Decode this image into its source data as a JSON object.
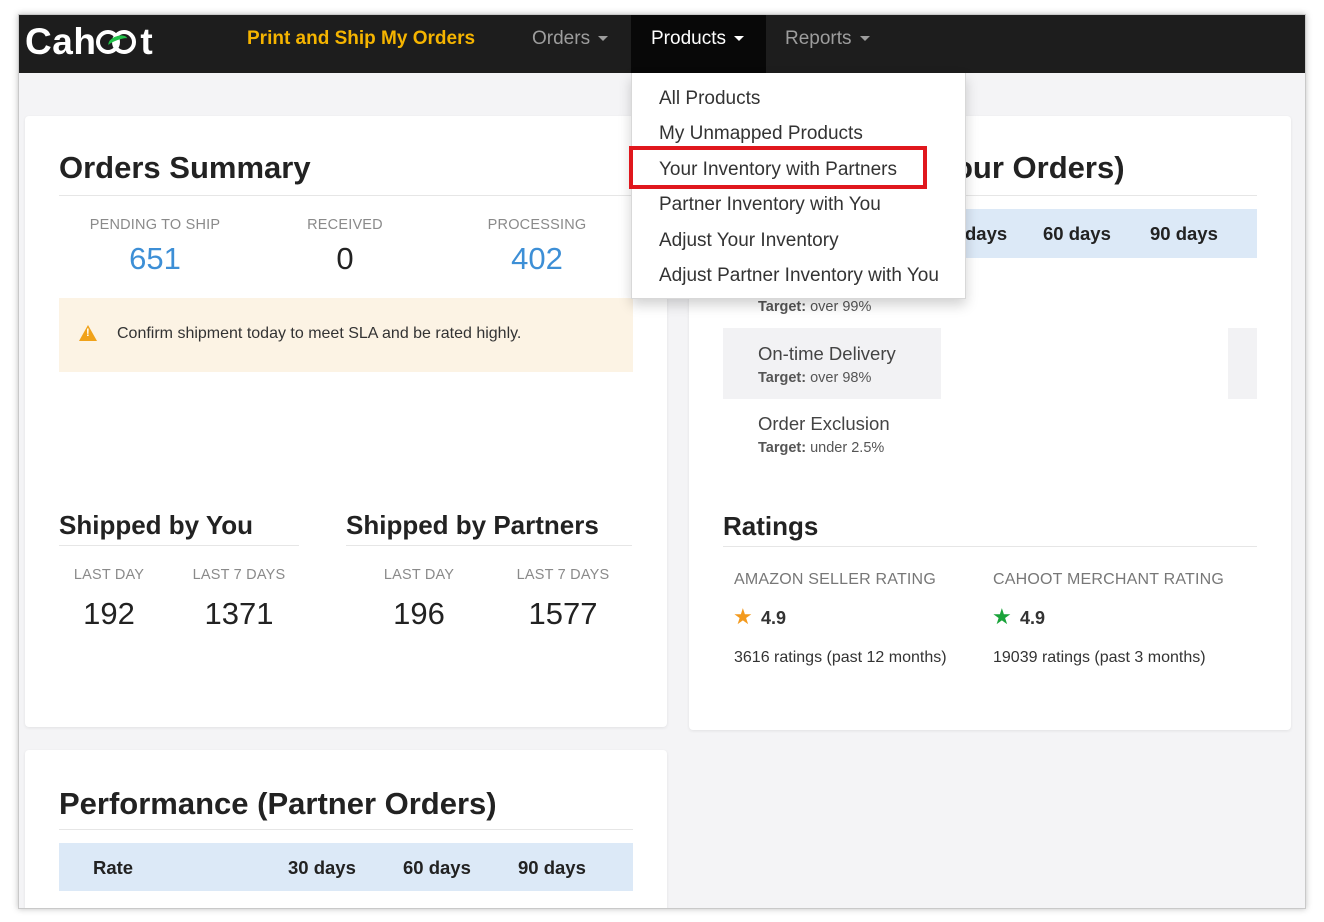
{
  "navbar": {
    "logo": "Cahoot",
    "print_ship": "Print and Ship My Orders",
    "orders": "Orders",
    "products": "Products",
    "reports": "Reports"
  },
  "products_menu": {
    "items": [
      "All Products",
      "My Unmapped Products",
      "Your Inventory with Partners",
      "Partner Inventory with You",
      "Adjust Your Inventory",
      "Adjust Partner Inventory with You"
    ],
    "highlighted_item": "Your Inventory with Partners",
    "highlight_color": "#e0171d"
  },
  "orders_summary": {
    "title": "Orders Summary",
    "stats": [
      {
        "label": "PENDING TO SHIP",
        "value": "651"
      },
      {
        "label": "RECEIVED",
        "value": "0"
      },
      {
        "label": "PROCESSING",
        "value": "402"
      }
    ],
    "alert": "Confirm shipment today to meet SLA and be rated highly.",
    "shipped_by_you": {
      "title": "Shipped by You",
      "cols": [
        {
          "label": "LAST DAY",
          "value": "192"
        },
        {
          "label": "LAST 7 DAYS",
          "value": "1371"
        }
      ]
    },
    "shipped_by_partners": {
      "title": "Shipped by Partners",
      "cols": [
        {
          "label": "LAST DAY",
          "value": "196"
        },
        {
          "label": "LAST 7 DAYS",
          "value": "1577"
        }
      ]
    }
  },
  "performance_your_orders": {
    "title_visible": "our Orders)",
    "headers": [
      "days",
      "60 days",
      "90 days"
    ],
    "metrics": [
      {
        "target_label": "Target:",
        "target": "over 99%"
      },
      {
        "name": "On-time Delivery",
        "target_label": "Target:",
        "target": "over 98%"
      },
      {
        "name": "Order Exclusion",
        "target_label": "Target:",
        "target": "under 2.5%"
      }
    ]
  },
  "ratings": {
    "title": "Ratings",
    "amazon": {
      "label": "AMAZON SELLER RATING",
      "value": "4.9",
      "count": "3616 ratings (past 12 months)",
      "star_color": "#f39a1e"
    },
    "cahoot": {
      "label": "CAHOOT MERCHANT RATING",
      "value": "4.9",
      "count": "19039 ratings (past 3 months)",
      "star_color": "#1aa33a"
    }
  },
  "performance_partner_orders": {
    "title": "Performance (Partner Orders)",
    "headers": [
      "Rate",
      "30 days",
      "60 days",
      "90 days"
    ]
  },
  "colors": {
    "navbar_bg": "#1d1d1d",
    "accent_yellow": "#f5b400",
    "link_blue": "#3d8fd6",
    "table_header_bg": "#dce9f7",
    "alert_bg": "#fcf3e4",
    "warning_icon": "#f0a21a"
  },
  "icons": [
    "caret-down-icon",
    "warning-icon",
    "star-icon"
  ]
}
